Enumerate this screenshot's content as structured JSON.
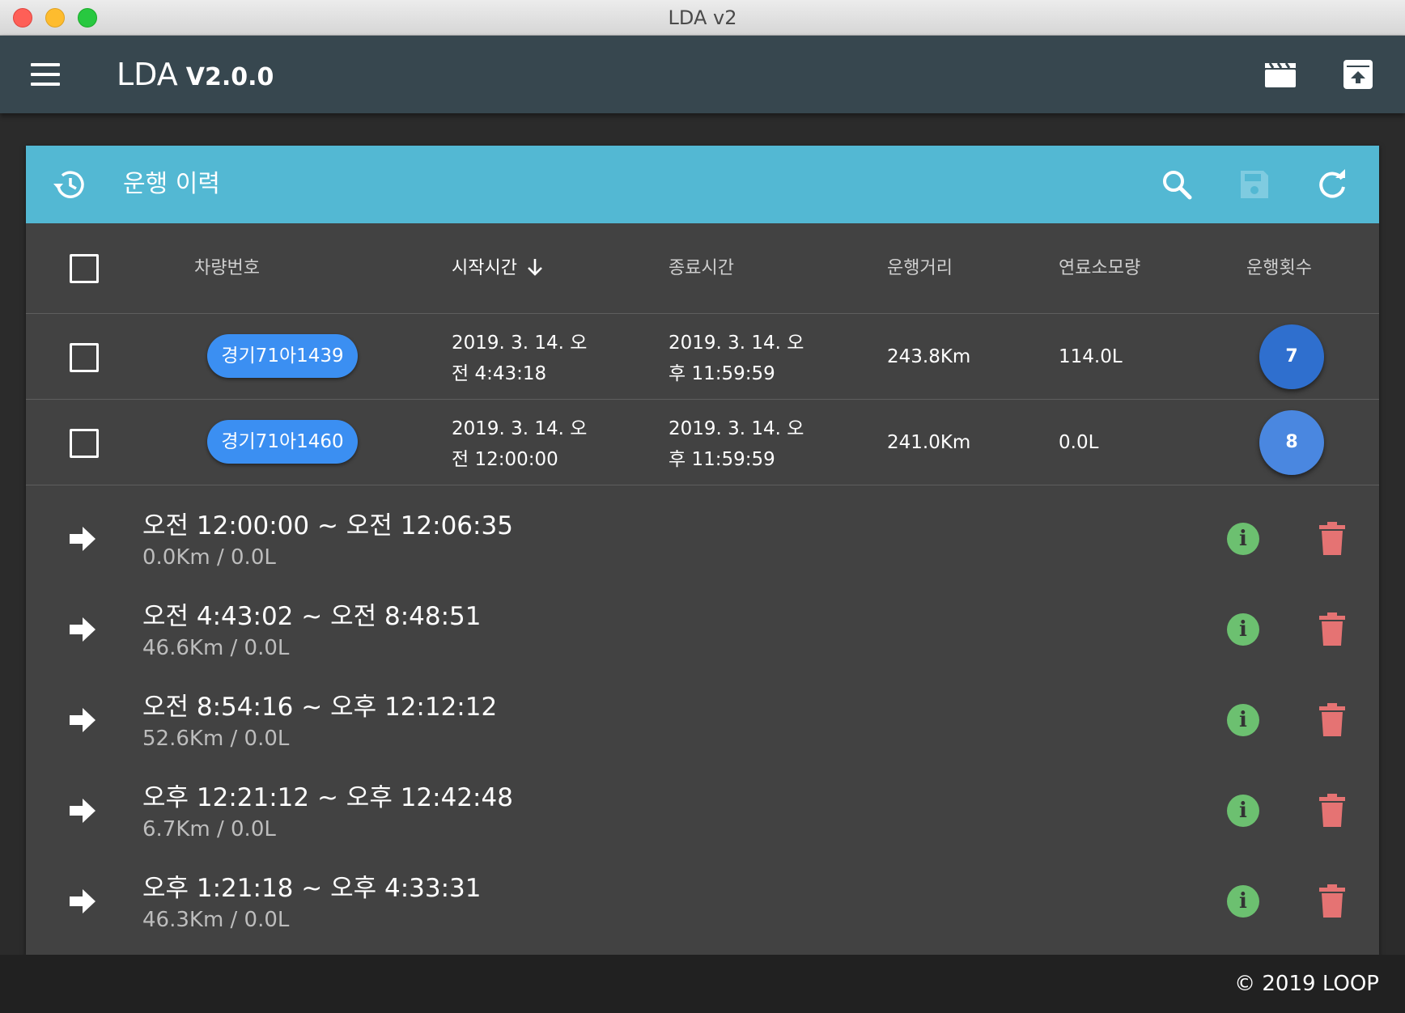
{
  "window": {
    "title": "LDA v2"
  },
  "appbar": {
    "title": "LDA",
    "version": "V2.0.0"
  },
  "card": {
    "title": "운행 이력"
  },
  "table": {
    "columns": [
      "차량번호",
      "시작시간",
      "종료시간",
      "운행거리",
      "연료소모량",
      "운행횟수"
    ],
    "sort_icon": "arrow-down-icon",
    "rows": [
      {
        "plate": "경기71아1439",
        "start_line1": "2019. 3. 14. 오",
        "start_line2": "전 4:43:18",
        "end_line1": "2019. 3. 14. 오",
        "end_line2": "후 11:59:59",
        "distance": "243.8Km",
        "fuel": "114.0L",
        "count": "7",
        "count_color": "#2f6fce"
      },
      {
        "plate": "경기71아1460",
        "start_line1": "2019. 3. 14. 오",
        "start_line2": "전 12:00:00",
        "end_line1": "2019. 3. 14. 오",
        "end_line2": "후 11:59:59",
        "distance": "241.0Km",
        "fuel": "0.0L",
        "count": "8",
        "count_color": "#4a87e0"
      }
    ]
  },
  "trips": [
    {
      "time": "오전 12:00:00 ~ 오전 12:06:35",
      "detail": "0.0Km / 0.0L"
    },
    {
      "time": "오전 4:43:02 ~ 오전 8:48:51",
      "detail": "46.6Km / 0.0L"
    },
    {
      "time": "오전 8:54:16 ~ 오후 12:12:12",
      "detail": "52.6Km / 0.0L"
    },
    {
      "time": "오후 12:21:12 ~ 오후 12:42:48",
      "detail": "6.7Km / 0.0L"
    },
    {
      "time": "오후 1:21:18 ~ 오후 4:33:31",
      "detail": "46.3Km / 0.0L"
    }
  ],
  "trip_info_glyph": "i",
  "footer": {
    "copyright": "© 2019 LOOP"
  },
  "colors": {
    "appbar": "#37474f",
    "card_header": "#53b8d3",
    "plate": "#3b8ff2",
    "info": "#6cc070",
    "trash": "#e57373"
  }
}
